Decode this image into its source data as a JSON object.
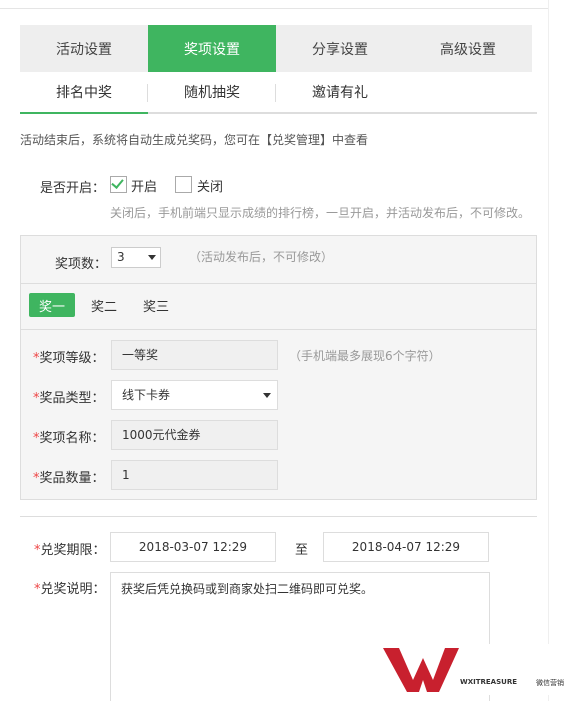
{
  "main_tabs": [
    "活动设置",
    "奖项设置",
    "分享设置",
    "高级设置"
  ],
  "sub_tabs": [
    "排名中奖",
    "随机抽奖",
    "邀请有礼"
  ],
  "notice": "活动结束后，系统将自动生成兑奖码，您可在【兑奖管理】中查看",
  "enable": {
    "label": "是否开启：",
    "on_label": "开启",
    "off_label": "关闭",
    "selected": "开启",
    "hint": "关闭后，手机前端只显示成绩的排行榜，一旦开启，并活动发布后，不可修改。"
  },
  "prize_count": {
    "label": "奖项数：",
    "value": "3",
    "hint": "（活动发布后，不可修改）"
  },
  "level_tabs": [
    "奖一",
    "奖二",
    "奖三"
  ],
  "fields": {
    "level": {
      "label": "奖项等级：",
      "value": "一等奖",
      "hint": "（手机端最多展现6个字符）"
    },
    "type": {
      "label": "奖品类型：",
      "value": "线下卡券"
    },
    "name": {
      "label": "奖项名称：",
      "value": "1000元代金券"
    },
    "quantity": {
      "label": "奖品数量：",
      "value": "1"
    }
  },
  "period": {
    "label": "兑奖期限：",
    "start": "2018-03-07 12:29",
    "to": "至",
    "end": "2018-04-07 12:29"
  },
  "description": {
    "label": "兑奖说明：",
    "value": "获奖后凭兑换码或到商家处扫二维码即可兑奖。"
  },
  "watermark": {
    "brand": "WXITREASURE",
    "brand_cn": "微信营销"
  },
  "colors": {
    "accent": "#3fb560",
    "required": "#ee4444",
    "logo_red": "#c8202e"
  }
}
